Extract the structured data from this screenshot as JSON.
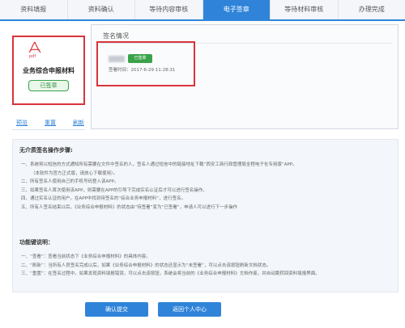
{
  "tabs": [
    {
      "label": "资料填报",
      "active": false
    },
    {
      "label": "资料确认",
      "active": false
    },
    {
      "label": "等待内容审核",
      "active": false
    },
    {
      "label": "电子签章",
      "active": true
    },
    {
      "label": "等待材料审核",
      "active": false
    },
    {
      "label": "办理完成",
      "active": false
    }
  ],
  "document": {
    "icon": "pdf-icon",
    "icon_text": "pdf",
    "title": "业务综合申报材料",
    "status": "已签章",
    "links": {
      "preview": "预览",
      "resign": "重置",
      "refresh": "刷新"
    }
  },
  "signature": {
    "title": "签名情况",
    "badge": "已签章",
    "time_label": "签署时间：",
    "time_value": "2017-6-29 11:28:31"
  },
  "instructions": {
    "title": "无介质签名操作步骤:",
    "steps": [
      "一、系统将以短信的方式通知所有需要在文件中签名的人，签名人通过短信中的链接地址下载“西安工商行政管理局全程电子化专用版”APP。",
      "（本软件为官方正式版，请放心下载使用）。",
      "二、所有签名人使用自己的手机号码登入该APP。",
      "三、如果签名人首次使用该APP，则需要在APP的引导下完成实名认证后才可以进行签名操作。",
      "四、通过实名认证的用户，在APP中找到待签名的“综合业务申报材料”，进行签名。",
      "五、所有人签名结束以后，《业务综合申报材料》的状态由“待签署”变为“已签署”，申请人可以进行下一步操作"
    ],
    "func_title": "功能键说明：",
    "func_items": [
      "一、“查看”：查看当前状态下《业务综合申报材料》的具体内容。",
      "二、“刷新”：当所有人员签名完成以后，如果《业务综合申报材料》的状态还显示为“未签署”，可以点击该按钮刷新文档状态。",
      "三、“重置”：在签名过程中，如果发现资料填报错误，可以点击该按钮，系统会将当前的《业务综合申报材料》文档作废，并自动跳转回资料填报界面。"
    ]
  },
  "buttons": {
    "submit": "确认提交",
    "back": "返回个人中心"
  },
  "colors": {
    "accent": "#2f84d9",
    "success": "#3aa24a",
    "highlight": "#d9343b"
  }
}
